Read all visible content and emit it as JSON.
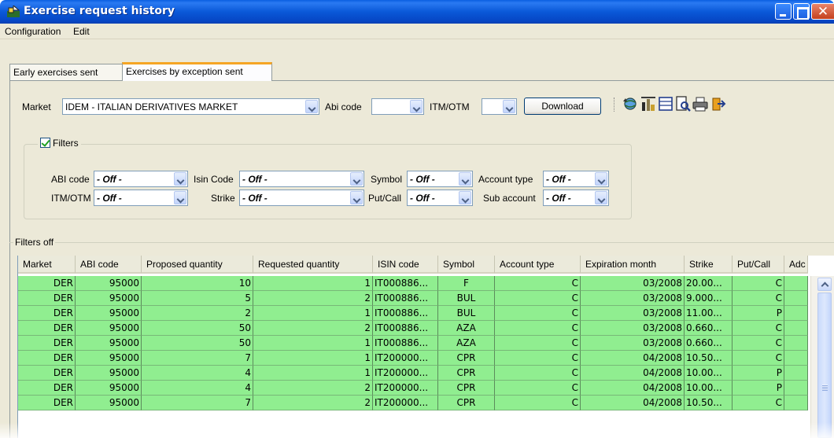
{
  "window": {
    "title": "Exercise request history",
    "minimize": "minimize",
    "maximize": "maximize",
    "close": "✕"
  },
  "menu": [
    "Configuration",
    "Edit"
  ],
  "tabs": [
    {
      "label": "Early exercises sent",
      "active": false
    },
    {
      "label": "Exercises by exception sent",
      "active": true
    }
  ],
  "toolbar": {
    "market_label": "Market",
    "market_value": "IDEM - ITALIAN DERIVATIVES MARKET",
    "abi_label": "Abi code",
    "abi_value": "",
    "itm_label": "ITM/OTM",
    "itm_value": "",
    "download_label": "Download",
    "icons": [
      "globe-refresh-icon",
      "chart-tools-icon",
      "grid-view-icon",
      "print-preview-icon",
      "print-icon",
      "export-icon"
    ]
  },
  "filters": {
    "title": "Filters",
    "checked": true,
    "abi_label": "ABI code",
    "abi_value": "- Off -",
    "isin_label": "Isin Code",
    "isin_value": "- Off -",
    "symbol_label": "Symbol",
    "symbol_value": "- Off -",
    "account_type_label": "Account type",
    "account_type_value": "- Off -",
    "itm_label": "ITM/OTM",
    "itm_value": "- Off -",
    "strike_label": "Strike",
    "strike_value": "- Off -",
    "putcall_label": "Put/Call",
    "putcall_value": "- Off -",
    "sub_account_label": "Sub account",
    "sub_account_value": "- Off -"
  },
  "table": {
    "caption": "Filters off",
    "columns": [
      "Market",
      "ABI code",
      "Proposed quantity",
      "Requested quantity",
      "ISIN code",
      "Symbol",
      "Account type",
      "Expiration month",
      "Strike",
      "Put/Call",
      "Adc"
    ],
    "rows": [
      [
        "DER",
        "95000",
        "10",
        "1",
        "IT000886...",
        "F",
        "C",
        "03/2008",
        "20.00...",
        "C",
        ""
      ],
      [
        "DER",
        "95000",
        "5",
        "2",
        "IT000886...",
        "BUL",
        "C",
        "03/2008",
        "9.000...",
        "C",
        ""
      ],
      [
        "DER",
        "95000",
        "2",
        "1",
        "IT000886...",
        "BUL",
        "C",
        "03/2008",
        "11.00...",
        "P",
        ""
      ],
      [
        "DER",
        "95000",
        "50",
        "2",
        "IT000886...",
        "AZA",
        "C",
        "03/2008",
        "0.660...",
        "C",
        ""
      ],
      [
        "DER",
        "95000",
        "50",
        "1",
        "IT000886...",
        "AZA",
        "C",
        "03/2008",
        "0.660...",
        "C",
        ""
      ],
      [
        "DER",
        "95000",
        "7",
        "1",
        "IT200000...",
        "CPR",
        "C",
        "04/2008",
        "10.50...",
        "C",
        ""
      ],
      [
        "DER",
        "95000",
        "4",
        "1",
        "IT200000...",
        "CPR",
        "C",
        "04/2008",
        "10.00...",
        "P",
        ""
      ],
      [
        "DER",
        "95000",
        "4",
        "2",
        "IT200000...",
        "CPR",
        "C",
        "04/2008",
        "10.00...",
        "P",
        ""
      ],
      [
        "DER",
        "95000",
        "7",
        "2",
        "IT200000...",
        "CPR",
        "C",
        "04/2008",
        "10.50...",
        "C",
        ""
      ]
    ],
    "row_color": "#90ee90"
  }
}
